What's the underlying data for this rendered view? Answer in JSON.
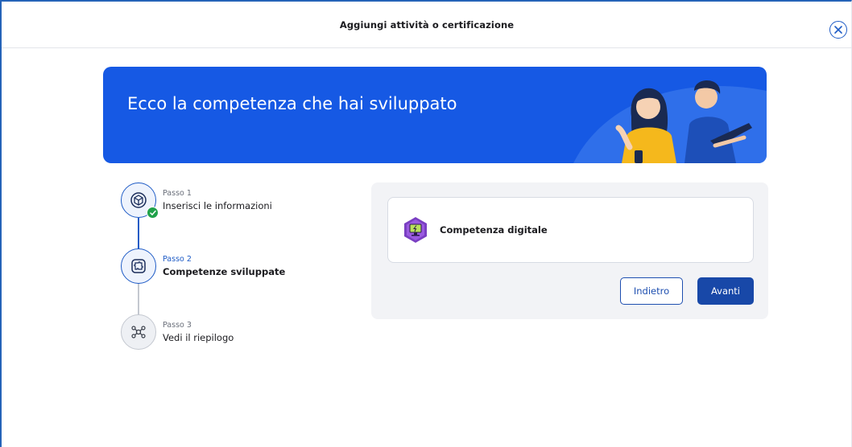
{
  "header": {
    "title": "Aggiungi attività o certificazione",
    "close_icon": "close-circle-icon"
  },
  "banner": {
    "title": "Ecco la competenza che hai sviluppato",
    "background": "#1659e4"
  },
  "stepper": {
    "steps": [
      {
        "label": "Passo 1",
        "name": "Inserisci le informazioni",
        "state": "completed",
        "icon": "cube-icon"
      },
      {
        "label": "Passo 2",
        "name": "Competenze sviluppate",
        "state": "active",
        "icon": "puzzle-icon"
      },
      {
        "label": "Passo 3",
        "name": "Vedi il riepilogo",
        "state": "todo",
        "icon": "network-icon"
      }
    ]
  },
  "competence": {
    "title": "Competenza digitale",
    "icon": "digital-competence-badge-icon",
    "badge_color": "#7a3fc2"
  },
  "actions": {
    "back_label": "Indietro",
    "next_label": "Avanti"
  },
  "colors": {
    "accent": "#1e5bc6",
    "primary_button": "#1848a8",
    "success": "#1fa14a"
  }
}
